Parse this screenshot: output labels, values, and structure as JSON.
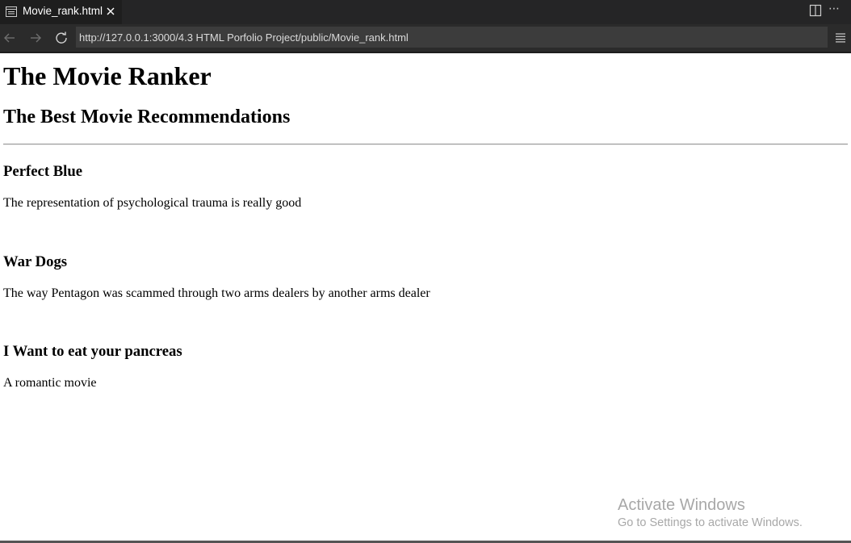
{
  "tab": {
    "title": "Movie_rank.html",
    "icon": "browser-preview-icon"
  },
  "toolbar": {
    "split_icon": "split-editor-icon",
    "more_icon": "more-actions-icon",
    "more_glyph": "⋯"
  },
  "navigation": {
    "back_icon": "arrow-left-icon",
    "forward_icon": "arrow-right-icon",
    "reload_icon": "reload-icon",
    "url": "http://127.0.0.1:3000/4.3 HTML Porfolio Project/public/Movie_rank.html",
    "menu_icon": "menu-icon"
  },
  "page": {
    "title": "The Movie Ranker",
    "subtitle": "The Best Movie Recommendations",
    "movies": [
      {
        "name": "Perfect Blue",
        "description": "The representation of psychological trauma is really good"
      },
      {
        "name": "War Dogs",
        "description": "The way Pentagon was scammed through two arms dealers by another arms dealer"
      },
      {
        "name": "I Want to eat your pancreas",
        "description": "A romantic movie"
      }
    ]
  },
  "watermark": {
    "title": "Activate Windows",
    "subtitle": "Go to Settings to activate Windows."
  },
  "colors": {
    "tabbar_bg": "#252526",
    "active_tab_bg": "#1e1e1e",
    "navbar_bg": "#2b2b2b",
    "url_bg": "#3c3c3c",
    "watermark_text": "#a8a8a8"
  }
}
